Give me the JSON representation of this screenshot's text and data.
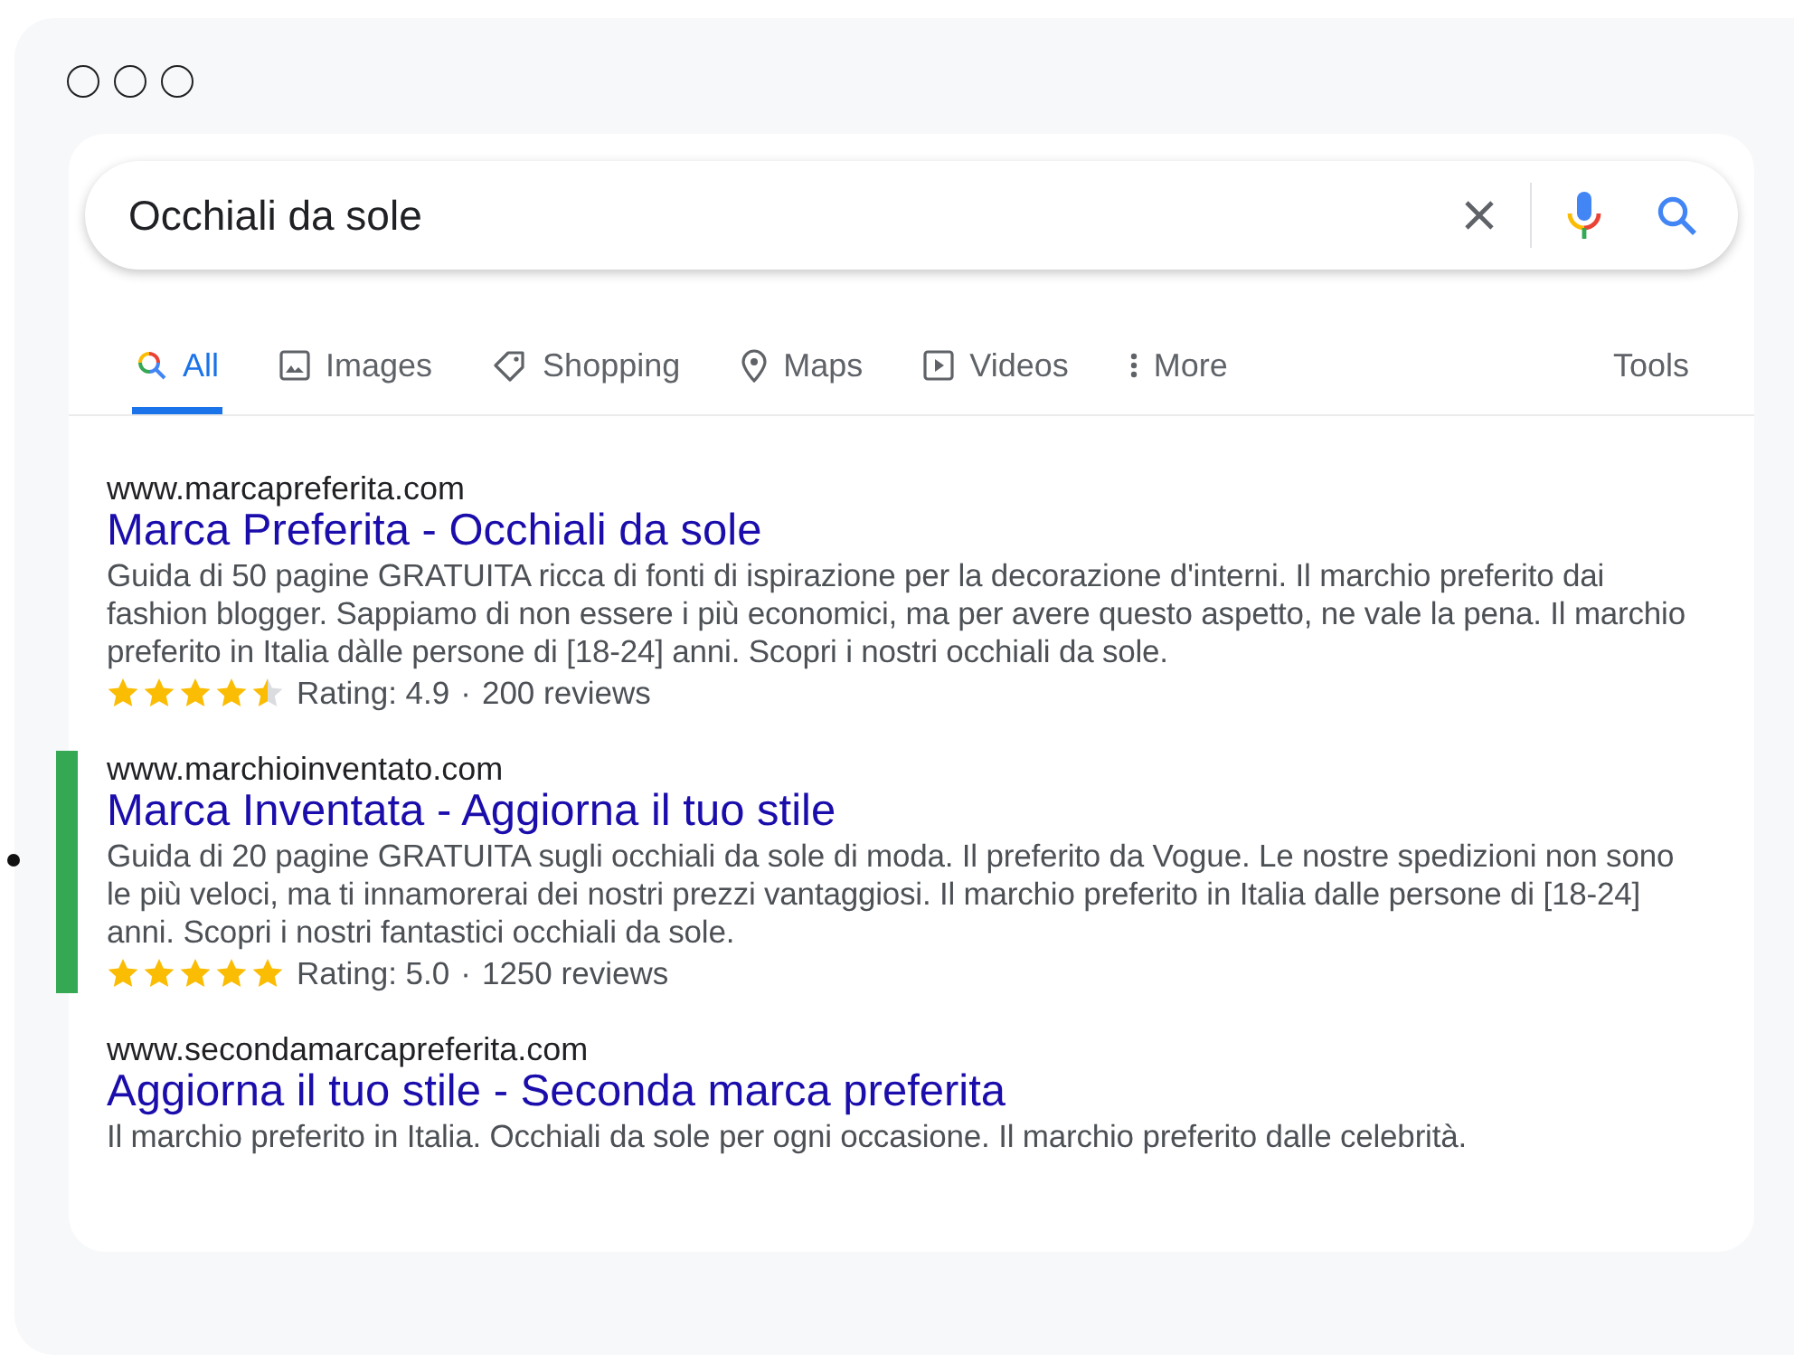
{
  "search": {
    "value": "Occhiali da sole"
  },
  "tabs": [
    {
      "label": "All",
      "selected": true
    },
    {
      "label": "Images",
      "selected": false
    },
    {
      "label": "Shopping",
      "selected": false
    },
    {
      "label": "Maps",
      "selected": false
    },
    {
      "label": "Videos",
      "selected": false
    },
    {
      "label": "More",
      "selected": false
    }
  ],
  "tools": "Tools",
  "results": [
    {
      "url": "www.marcapreferita.com",
      "title": "Marca Preferita - Occhiali da sole",
      "snippet": "Guida di 50 pagine GRATUITA ricca di fonti di ispirazione per la decorazione d'interni. Il marchio preferito dai fashion blogger. Sappiamo di non essere i più economici, ma per avere questo aspetto, ne vale la pena. Il marchio preferito in Italia dàlle persone di [18-24] anni. Scopri i nostri occhiali da sole.",
      "stars": 4.5,
      "rating": "Rating: 4.9",
      "separator": "·",
      "reviews": "200 reviews",
      "highlighted": false
    },
    {
      "url": "www.marchioinventato.com",
      "title": "Marca Inventata - Aggiorna il tuo stile",
      "snippet": "Guida di 20 pagine GRATUITA sugli occhiali da sole di moda. Il preferito da Vogue. Le nostre spedizioni non sono le più veloci, ma ti innamorerai dei nostri prezzi vantaggiosi. Il marchio preferito in Italia dalle persone di [18-24] anni. Scopri i nostri fantastici occhiali da sole.",
      "stars": 5,
      "rating": "Rating: 5.0",
      "separator": "·",
      "reviews": "1250 reviews",
      "highlighted": true
    },
    {
      "url": "www.secondamarcapreferita.com",
      "title": "Aggiorna il tuo stile - Seconda marca preferita",
      "snippet": "Il marchio preferito in Italia. Occhiali da sole per ogni occasione. Il marchio preferito dalle celebrità.",
      "highlighted": false
    }
  ]
}
